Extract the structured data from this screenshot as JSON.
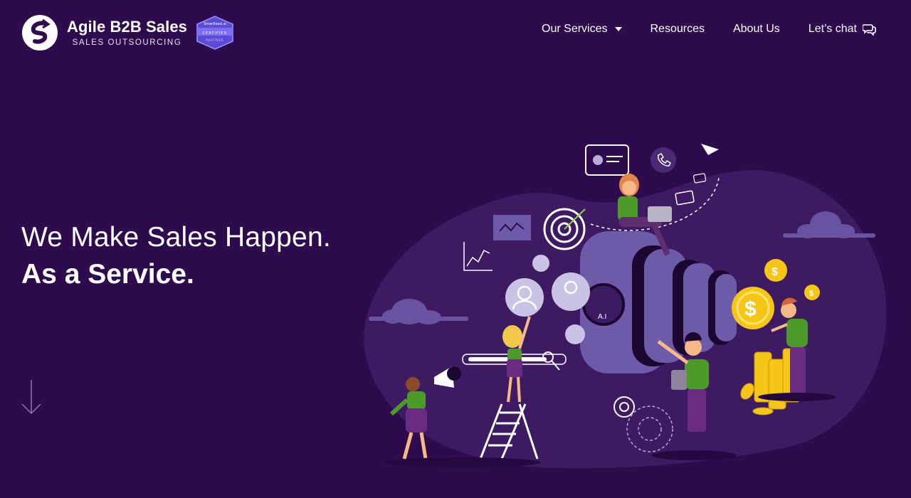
{
  "brand": {
    "name": "Agile B2B Sales",
    "tagline": "SALES OUTSOURCING",
    "badge_top": "Smartlead.ai",
    "badge_label": "CERTIFIED",
    "badge_sub": "PARTNER"
  },
  "nav": {
    "items": [
      {
        "label": "Our Services",
        "icon": "chevron-down-icon"
      },
      {
        "label": "Resources"
      },
      {
        "label": "About Us"
      },
      {
        "label": "Let’s chat",
        "icon": "chat-bubbles-icon"
      }
    ]
  },
  "hero": {
    "line1": "We Make Sales Happen.",
    "line2": "As a Service."
  },
  "illustration": {
    "camera_badge": "A.I"
  },
  "colors": {
    "background": "#2e0b4c",
    "blob": "#3d1a62",
    "accent_purple": "#6d5aa8",
    "coin_gold": "#f5c518",
    "text": "#ffffff"
  }
}
